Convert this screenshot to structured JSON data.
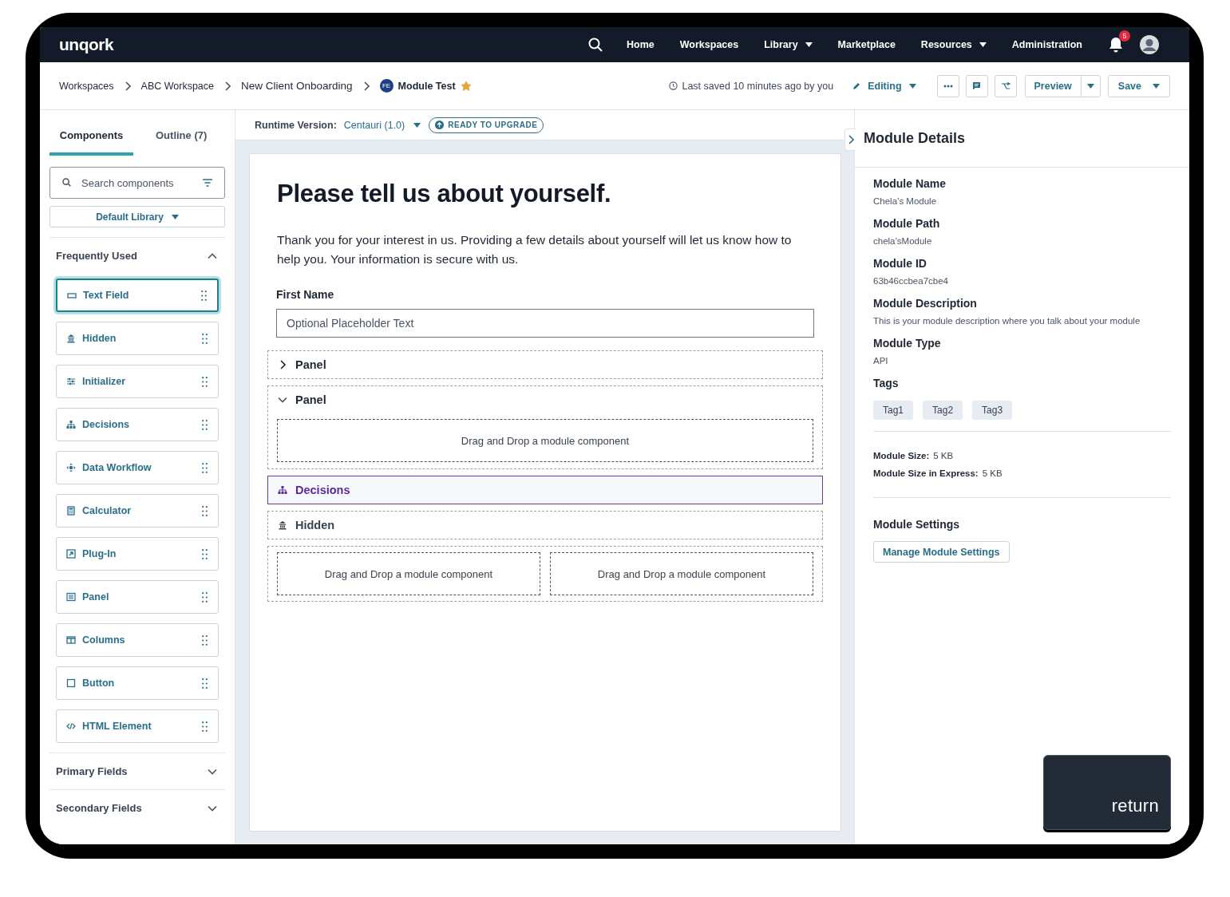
{
  "logo": "unqork",
  "nav": {
    "items": [
      {
        "label": "Home",
        "has_menu": false
      },
      {
        "label": "Workspaces",
        "has_menu": false
      },
      {
        "label": "Library",
        "has_menu": true
      },
      {
        "label": "Marketplace",
        "has_menu": false
      },
      {
        "label": "Resources",
        "has_menu": true
      },
      {
        "label": "Administration",
        "has_menu": false
      }
    ],
    "notifications": "5"
  },
  "breadcrumbs": [
    {
      "label": "Workspaces"
    },
    {
      "label": "ABC Workspace"
    },
    {
      "label": "New Client Onboarding"
    }
  ],
  "module": {
    "badge": "FE",
    "title": "Module Test",
    "starred": true
  },
  "last_saved": "Last saved 10 minutes ago by you",
  "mode": "Editing",
  "actions": {
    "preview": "Preview",
    "save": "Save"
  },
  "sidebar": {
    "tabs": [
      {
        "label": "Components",
        "selected": true
      },
      {
        "label": "Outline (7)",
        "selected": false
      }
    ],
    "search": {
      "placeholder": "Search components"
    },
    "library": "Default Library",
    "sections": [
      {
        "title": "Frequently Used",
        "expanded": true,
        "items": [
          {
            "label": "Text Field",
            "kind": "text-field",
            "selected": true
          },
          {
            "label": "Hidden",
            "kind": "hidden",
            "selected": false
          },
          {
            "label": "Initializer",
            "kind": "initializer",
            "selected": false
          },
          {
            "label": "Decisions",
            "kind": "decisions",
            "selected": false
          },
          {
            "label": "Data Workflow",
            "kind": "workflow",
            "selected": false
          },
          {
            "label": "Calculator",
            "kind": "calculator",
            "selected": false
          },
          {
            "label": "Plug-In",
            "kind": "plugin",
            "selected": false
          },
          {
            "label": "Panel",
            "kind": "panel",
            "selected": false
          },
          {
            "label": "Columns",
            "kind": "columns",
            "selected": false
          },
          {
            "label": "Button",
            "kind": "button",
            "selected": false
          },
          {
            "label": "HTML Element",
            "kind": "html",
            "selected": false
          }
        ]
      },
      {
        "title": "Primary Fields",
        "expanded": false
      },
      {
        "title": "Secondary Fields",
        "expanded": false
      }
    ]
  },
  "runtime": {
    "label": "Runtime Version:",
    "version": "Centauri (1.0)",
    "badge": "READY TO UPGRADE"
  },
  "canvas": {
    "heading": "Please tell us about yourself.",
    "intro": "Thank you for your interest in us. Providing a few details about yourself will let us know how to help you. Your information is secure with us.",
    "blocks": [
      {
        "kind": "field",
        "label": "First Name",
        "placeholder": "Optional Placeholder Text"
      },
      {
        "kind": "panel",
        "title": "Panel",
        "expanded": false
      },
      {
        "kind": "panel",
        "title": "Panel",
        "expanded": true,
        "drops": [
          "Drag and Drop a module component"
        ]
      },
      {
        "kind": "decisions",
        "title": "Decisions",
        "selected": true
      },
      {
        "kind": "hidden",
        "title": "Hidden",
        "selected": false
      },
      {
        "kind": "columns",
        "drops": [
          "Drag and Drop a module component",
          "Drag and Drop a module component"
        ]
      }
    ]
  },
  "details": {
    "title": "Module Details",
    "fields": [
      {
        "label": "Module Name",
        "value": "Chela’s Module"
      },
      {
        "label": "Module Path",
        "value": "chela’sModule"
      },
      {
        "label": "Module ID",
        "value": "63b46ccbea7cbe4"
      },
      {
        "label": "Module Description",
        "value": "This is your module description where you talk about your module"
      },
      {
        "label": "Module Type",
        "value": "API"
      }
    ],
    "tags_label": "Tags",
    "tags": [
      "Tag1",
      "Tag2",
      "Tag3"
    ],
    "sizes": [
      {
        "label": "Module Size:",
        "value": "5 KB"
      },
      {
        "label": "Module Size in Express:",
        "value": "5 KB"
      }
    ],
    "settings_label": "Module Settings",
    "settings_button": "Manage Module Settings"
  },
  "key": "return"
}
